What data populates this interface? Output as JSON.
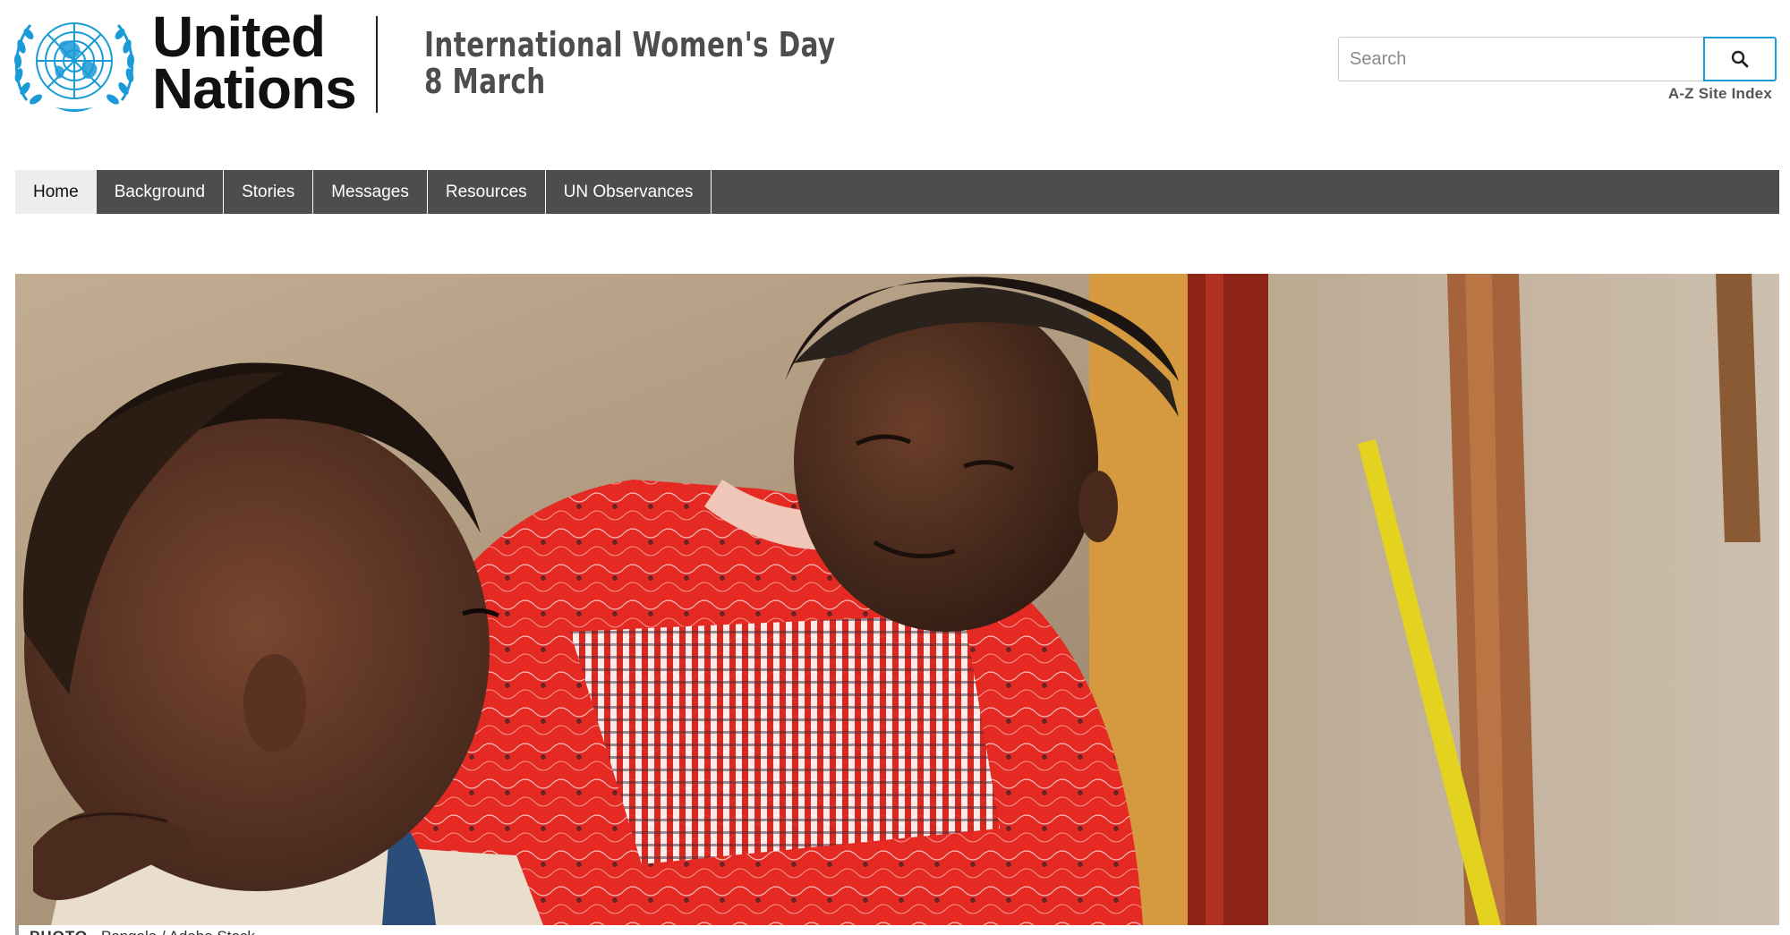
{
  "header": {
    "logo_line1": "United",
    "logo_line2": "Nations",
    "site_title_line1": "International Women's Day",
    "site_title_line2": "8 March",
    "search_placeholder": "Search",
    "search_icon": "search-icon",
    "az_index_label": "A-Z Site Index"
  },
  "nav": {
    "items": [
      {
        "label": "Home",
        "active": true
      },
      {
        "label": "Background",
        "active": false
      },
      {
        "label": "Stories",
        "active": false
      },
      {
        "label": "Messages",
        "active": false
      },
      {
        "label": "Resources",
        "active": false
      },
      {
        "label": "UN Observances",
        "active": false
      }
    ]
  },
  "hero": {
    "caption_label": "PHOTO",
    "caption_credit": "Pongala / Adobe Stock"
  },
  "colors": {
    "nav_bg": "#4d4d4d",
    "nav_active_bg": "#eeeeee",
    "un_blue": "#1a9bd7",
    "title_gray": "#4d4d4d"
  }
}
